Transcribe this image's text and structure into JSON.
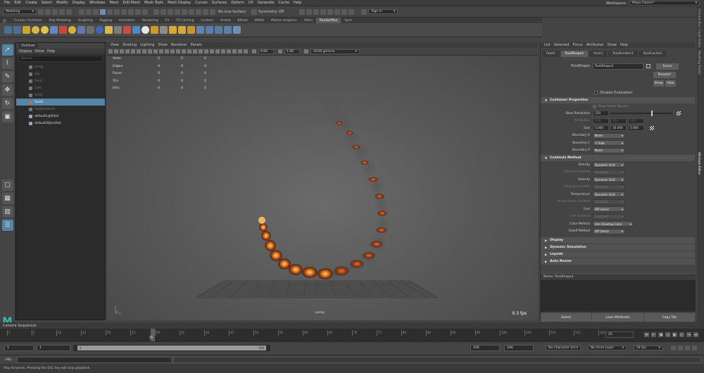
{
  "menubar": {
    "items": [
      "File",
      "Edit",
      "Create",
      "Select",
      "Modify",
      "Display",
      "Windows",
      "Mesh",
      "Edit Mesh",
      "Mesh Tools",
      "Mesh Display",
      "Curves",
      "Surfaces",
      "Deform",
      "UV",
      "Generate",
      "Cache",
      "Help"
    ],
    "workspace_label": "Workspace:",
    "workspace_value": "Maya Classic*"
  },
  "statusline": {
    "mode": "Modeling",
    "live_surface": "No Live Surface",
    "symmetry": "Symmetry: Off",
    "signin": "Sign In"
  },
  "shelf": {
    "tabs": [
      "Curves / Surfaces",
      "Poly Modeling",
      "Sculpting",
      "Rigging",
      "Animation",
      "Rendering",
      "FX",
      "FX Caching",
      "Custom",
      "Arnold",
      "Bifrost",
      "MASH",
      "Motion Graphics",
      "XGen",
      "RenderMan",
      "Sync"
    ],
    "active_tab": "RenderMan"
  },
  "outliner": {
    "title": "Outliner",
    "menu": [
      "Display",
      "Show",
      "Help"
    ],
    "search_placeholder": "Search...",
    "items": [
      {
        "label": "persp",
        "state": "hidden"
      },
      {
        "label": "top",
        "state": "hidden"
      },
      {
        "label": "front",
        "state": "hidden"
      },
      {
        "label": "side",
        "state": "hidden"
      },
      {
        "label": "Grid1",
        "state": "hidden"
      },
      {
        "label": "fluid1",
        "state": "selected"
      },
      {
        "label": "fluidEmitter1",
        "state": "hidden"
      },
      {
        "label": "defaultLightSet",
        "state": "visible"
      },
      {
        "label": "defaultObjectSet",
        "state": "visible"
      }
    ]
  },
  "viewport": {
    "menu": [
      "View",
      "Shading",
      "Lighting",
      "Show",
      "Renderer",
      "Panels"
    ],
    "exposure": "0.00",
    "gamma": "1.00",
    "color_space": "sRGB gamma",
    "hud": [
      {
        "label": "Verts:",
        "v1": "0",
        "v2": "0",
        "v3": "0"
      },
      {
        "label": "Edges:",
        "v1": "0",
        "v2": "0",
        "v3": "0"
      },
      {
        "label": "Faces:",
        "v1": "0",
        "v2": "0",
        "v3": "0"
      },
      {
        "label": "Tris:",
        "v1": "0",
        "v2": "0",
        "v3": "0"
      },
      {
        "label": "UVs:",
        "v1": "0",
        "v2": "0",
        "v3": "0"
      }
    ],
    "camera": "persp",
    "fps": "0.3 fps"
  },
  "sidetabs": [
    "Channel Box / Layer Editor",
    "Modeling Toolkit",
    "Attribute Editor"
  ],
  "attribute_editor": {
    "menu": [
      "List",
      "Selected",
      "Focus",
      "Attributes",
      "Show",
      "Help"
    ],
    "tabs": [
      "fluid1",
      "fluidShape1",
      "time1",
      "fluidEmitter1",
      "fluidCache1"
    ],
    "active_tab": "fluidShape1",
    "node_label": "fluidShape:",
    "node_value": "fluidShape1",
    "focus_btn": "Focus",
    "presets_btn": "Presets*",
    "show_btn": "Show",
    "hide_btn": "Hide",
    "disable_eval": "Disable Evaluation",
    "sec_container": "Container Properties",
    "keep_voxels": "Keep Voxels Square",
    "base_res_label": "Base Resolution",
    "base_res_value": "120",
    "resolution_label": "Resolution",
    "resolution_values": [
      "120",
      "250",
      "120"
    ],
    "size_label": "Size",
    "size_values": [
      "5.000",
      "10.000",
      "5.000"
    ],
    "bx_label": "Boundary X",
    "bx_value": "None",
    "by_label": "Boundary Y",
    "by_value": "-Y Side",
    "bz_label": "Boundary Z",
    "bz_value": "None",
    "sec_contents": "Contents Method",
    "cm_rows": [
      {
        "label": "Density",
        "value": "Dynamic Grid",
        "dim": false
      },
      {
        "label": "Density Gradient",
        "value": "Constant",
        "dim": true
      },
      {
        "label": "Velocity",
        "value": "Dynamic Grid",
        "dim": false
      },
      {
        "label": "Velocity Gradient",
        "value": "Constant",
        "dim": true
      },
      {
        "label": "Temperature",
        "value": "Dynamic Grid",
        "dim": false
      },
      {
        "label": "Temperature Gradient",
        "value": "Constant",
        "dim": true
      },
      {
        "label": "Fuel",
        "value": "Off (zero)",
        "dim": false
      },
      {
        "label": "Fuel Gradient",
        "value": "Constant",
        "dim": true
      },
      {
        "label": "Color Method",
        "value": "Use Shading Color",
        "dim": false
      },
      {
        "label": "Falloff Method",
        "value": "Off (zero)",
        "dim": false
      }
    ],
    "collapsed_sections": [
      "Display",
      "Dynamic Simulation",
      "Liquids",
      "Auto Resize"
    ],
    "notes_label": "Notes:  fluidShape1",
    "bottom_buttons": [
      "Select",
      "Load Attributes",
      "Copy Tab"
    ]
  },
  "camera_sequencer": "Camera Sequencer",
  "timeline": {
    "ticks": [
      "1",
      "5",
      "10",
      "15",
      "20",
      "25",
      "30",
      "35",
      "40",
      "45",
      "50",
      "55",
      "60",
      "65",
      "70",
      "75",
      "80",
      "85",
      "90",
      "95",
      "100",
      "105",
      "110",
      "115",
      "120"
    ],
    "current_frame": "25",
    "current_frame_field": "25"
  },
  "range": {
    "start": "1",
    "inner_start": "1",
    "slider_left": "1",
    "slider_right": "100",
    "inner_end": "100",
    "end": "200",
    "character_set": "No Character Set",
    "anim_layer": "No Anim Layer",
    "fps": "24 fps"
  },
  "cmd": {
    "lang": "MEL"
  },
  "help_line": "Play forwards. Pressing the ESC key will stop playback.",
  "colors": {
    "accent": "#5285a6",
    "fluid_fire": "#d8661c",
    "fluid_smoke": "#6e6e6e"
  }
}
